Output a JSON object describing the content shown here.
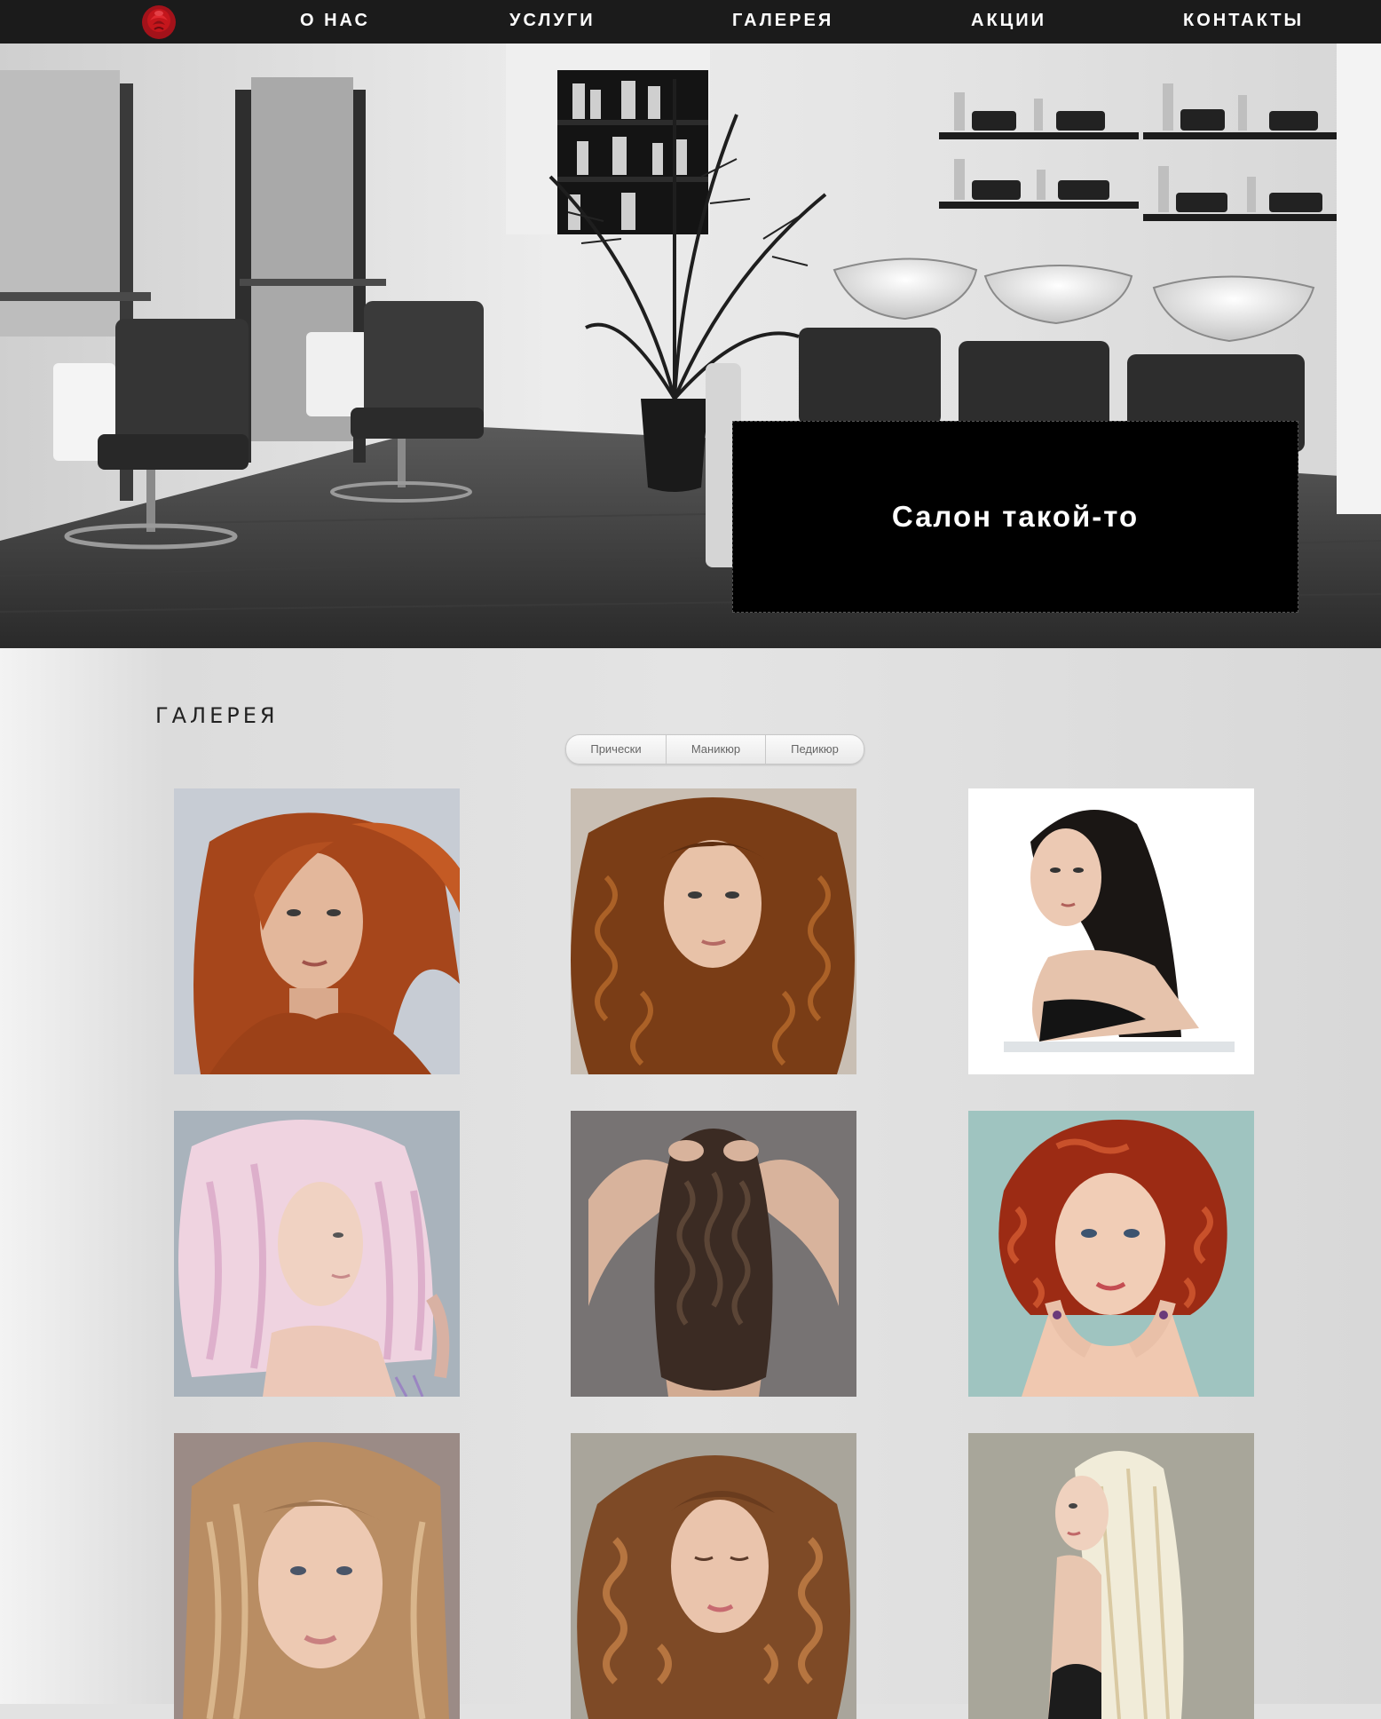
{
  "nav": {
    "logo": "rose-logo-icon",
    "items": [
      {
        "label": "О НАС"
      },
      {
        "label": "УСЛУГИ"
      },
      {
        "label": "ГАЛЕРЕЯ"
      },
      {
        "label": "АКЦИИ"
      },
      {
        "label": "КОНТАКТЫ"
      }
    ]
  },
  "hero": {
    "title": "Салон такой-то",
    "image": "salon-interior-photo"
  },
  "gallery": {
    "title": "ГАЛЕРЕЯ",
    "filters": [
      "Прически",
      "Маникюр",
      "Педикюр"
    ],
    "photos": [
      "hair-photo-red-windswept",
      "hair-photo-brown-curls",
      "hair-photo-black-straight",
      "hair-photo-pastel-pink",
      "hair-photo-dark-waves-back",
      "hair-photo-red-short-curls",
      "hair-photo-blonde-natural",
      "hair-photo-auburn-curls",
      "hair-photo-platinum-straight"
    ]
  },
  "colors": {
    "nav_bg": "#1b1b1b",
    "hero_box": "#000000",
    "page_bg": "#e2e2e2",
    "logo_red": "#c4161c"
  }
}
